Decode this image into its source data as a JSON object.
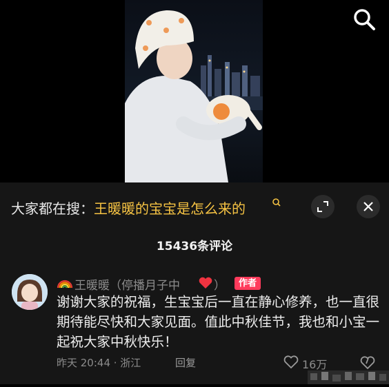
{
  "video": {
    "description_icon": "video-thumbnail"
  },
  "header": {
    "search_icon": "search-icon"
  },
  "search_suggestion": {
    "prefix": "大家都在搜：",
    "query": "王暖暖的宝宝是怎么来的",
    "expand_icon": "expand-icon",
    "close_icon": "close-icon"
  },
  "comments": {
    "count_label": "15436条评论",
    "items": [
      {
        "avatar": "avatar",
        "badge_icon": "rainbow-icon",
        "username": "王暖暖（停播月子中",
        "username_close": "）",
        "heart_icon": "heart-icon",
        "author_badge": "作者",
        "text": "谢谢大家的祝福，生宝宝后一直在静心修养，也一直很期待能尽快和大家见面。值此中秋佳节，我也和小宝一起祝大家中秋快乐！",
        "time_location": "昨天 20:44 · 浙江",
        "reply_label": "回复",
        "like_count": "16万",
        "like_icon": "like-heart-icon",
        "dislike_icon": "dislike-icon"
      }
    ]
  },
  "colors": {
    "accent": "#f6c343",
    "author_badge": "#ff3b5c",
    "background": "#161616"
  }
}
